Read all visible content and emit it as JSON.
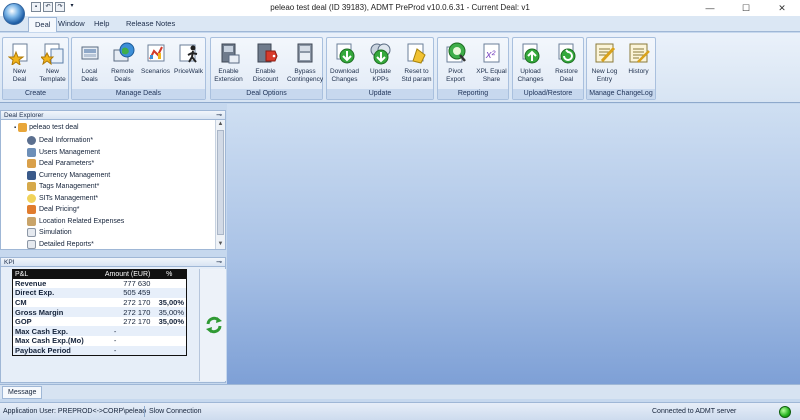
{
  "window": {
    "title": "peleao test deal (ID 39183), ADMT PreProd v10.0.6.31 - Current Deal: v1",
    "minimize": "—",
    "maximize": "☐",
    "close": "✕"
  },
  "menu_tabs": [
    {
      "label": "Deal",
      "active": true
    },
    {
      "label": "Window",
      "active": false
    },
    {
      "label": "Help",
      "active": false
    },
    {
      "label": "Release Notes",
      "active": false
    }
  ],
  "ribbon": {
    "groups": [
      {
        "label": "Create",
        "buttons": [
          {
            "label": "New\nDeal",
            "icon": "new-deal-star-icon"
          },
          {
            "label": "New\nTemplate",
            "icon": "new-template-icon"
          }
        ]
      },
      {
        "label": "Manage Deals",
        "buttons": [
          {
            "label": "Local\nDeals",
            "icon": "local-deals-icon"
          },
          {
            "label": "Remote\nDeals",
            "icon": "remote-deals-globe-icon"
          },
          {
            "label": "Scenarios",
            "icon": "scenarios-icon"
          },
          {
            "label": "PriceWalk",
            "icon": "pricewalk-icon"
          }
        ]
      },
      {
        "label": "Deal Options",
        "buttons": [
          {
            "label": "Enable\nExtension",
            "icon": "enable-extension-icon"
          },
          {
            "label": "Enable\nDiscount",
            "icon": "enable-discount-icon"
          },
          {
            "label": "Bypass\nContingency",
            "icon": "bypass-contingency-icon"
          }
        ]
      },
      {
        "label": "Update",
        "buttons": [
          {
            "label": "Download\nChanges",
            "icon": "download-changes-icon"
          },
          {
            "label": "Update\nKPPs",
            "icon": "update-kpps-icon"
          },
          {
            "label": "Reset to\nStd param",
            "icon": "reset-std-param-icon"
          }
        ]
      },
      {
        "label": "Reporting",
        "buttons": [
          {
            "label": "Pivot\nExport",
            "icon": "pivot-export-icon"
          },
          {
            "label": "XPL Equal\nShare",
            "icon": "xpl-equal-share-icon"
          }
        ]
      },
      {
        "label": "Upload/Restore",
        "buttons": [
          {
            "label": "Upload\nChanges",
            "icon": "upload-changes-icon"
          },
          {
            "label": "Restore\nDeal",
            "icon": "restore-deal-icon"
          }
        ]
      },
      {
        "label": "Manage ChangeLog",
        "buttons": [
          {
            "label": "New Log\nEntry",
            "icon": "new-log-entry-icon"
          },
          {
            "label": "History",
            "icon": "history-icon"
          }
        ]
      }
    ]
  },
  "deal_explorer": {
    "title": "Deal Explorer",
    "root": "peleao test deal",
    "items": [
      "Deal Information*",
      "Users Management",
      "Deal Parameters*",
      "Currency Management",
      "Tags Management*",
      "SITs Management*",
      "Deal Pricing*",
      "Location Related Expenses",
      "Simulation",
      "Detailed Reports*"
    ]
  },
  "kpi": {
    "title": "KPI",
    "headers": [
      "P&L",
      "Amount (EUR)",
      "%"
    ],
    "rows": [
      {
        "label": "Revenue",
        "amount": "777 630",
        "pct": ""
      },
      {
        "label": "Direct Exp.",
        "amount": "505 459",
        "pct": ""
      },
      {
        "label": "CM",
        "amount": "272 170",
        "pct": "35,00%"
      },
      {
        "label": "Gross Margin",
        "amount": "272 170",
        "pct": "35,00%"
      },
      {
        "label": "GOP",
        "amount": "272 170",
        "pct": "35,00%"
      },
      {
        "label": "Max Cash Exp.",
        "amount": "-",
        "pct": ""
      },
      {
        "label": "Max Cash Exp.(Mo)",
        "amount": "-",
        "pct": ""
      },
      {
        "label": "Payback Period",
        "amount": "-",
        "pct": ""
      }
    ]
  },
  "message_tab": "Message",
  "status": {
    "user": "Application User: PREPROD<->CORP\\peleao",
    "connection": "Slow Connection",
    "server": "Connected to ADMT server"
  }
}
